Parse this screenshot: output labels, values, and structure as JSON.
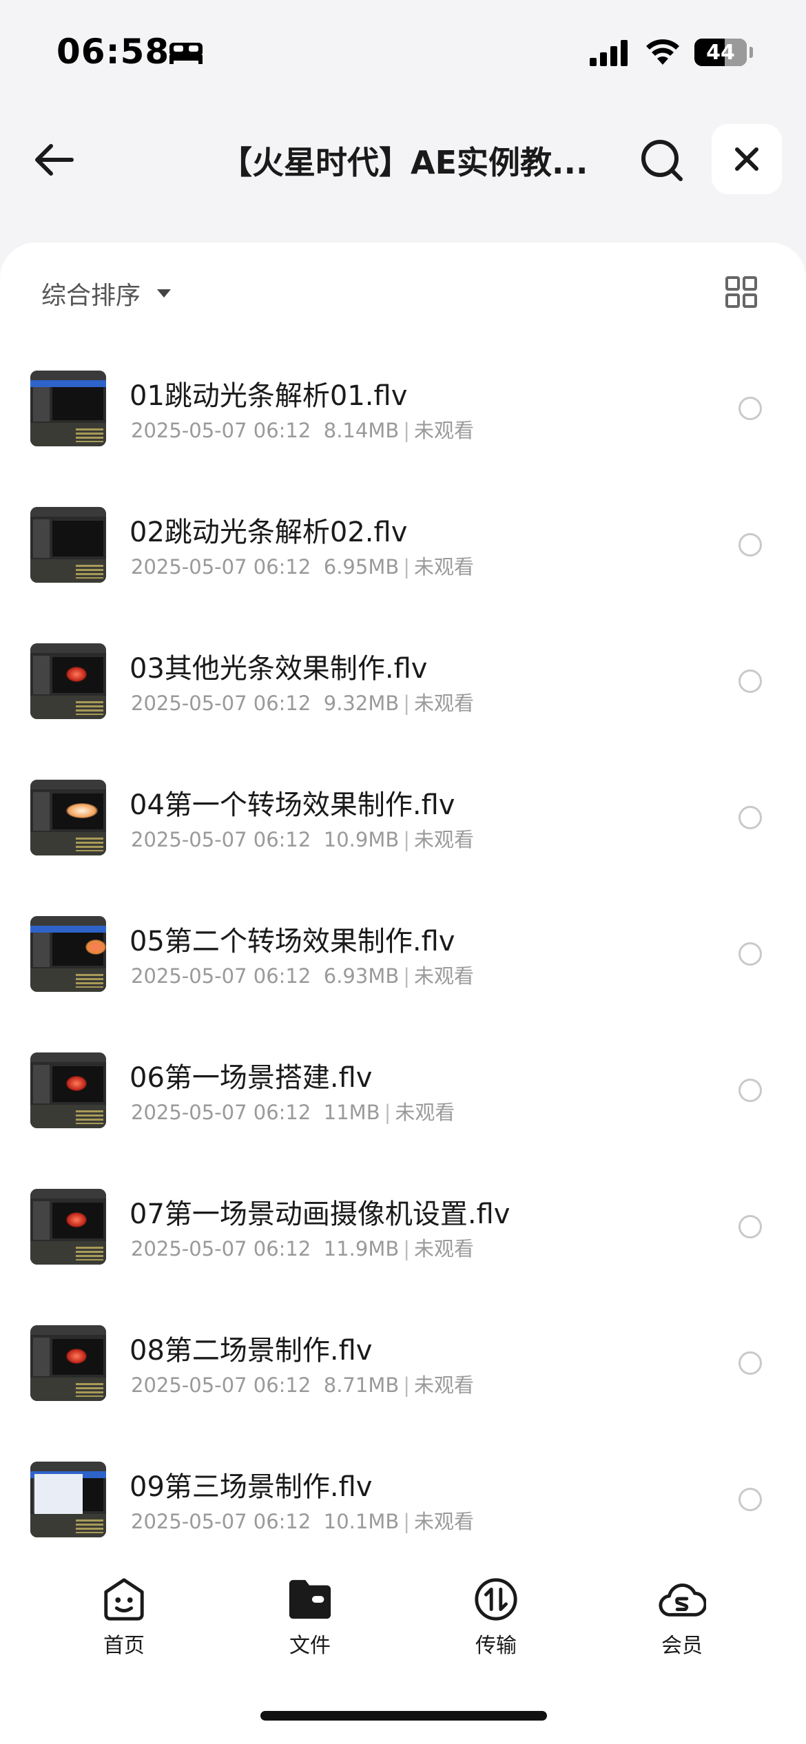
{
  "status_bar": {
    "time": "06:58",
    "battery": "44",
    "battery_level_percent": 44,
    "icons": [
      "bed-icon",
      "signal-icon",
      "wifi-icon",
      "battery-icon"
    ]
  },
  "header": {
    "title": "【火星时代】AE实例教...",
    "back_icon": "arrow-left-icon",
    "search_icon": "search-icon",
    "close_icon": "close-icon"
  },
  "toolbar": {
    "sort_label": "综合排序",
    "sort_icon": "caret-down-icon",
    "view_icon": "grid-view-icon"
  },
  "files": [
    {
      "name": "01跳动光条解析01.flv",
      "date": "2025-05-07 06:12",
      "size": "8.14MB",
      "status": "未观看",
      "thumb": "blue"
    },
    {
      "name": "02跳动光条解析02.flv",
      "date": "2025-05-07 06:12",
      "size": "6.95MB",
      "status": "未观看",
      "thumb": "dark"
    },
    {
      "name": "03其他光条效果制作.flv",
      "date": "2025-05-07 06:12",
      "size": "9.32MB",
      "status": "未观看",
      "thumb": "red"
    },
    {
      "name": "04第一个转场效果制作.flv",
      "date": "2025-05-07 06:12",
      "size": "10.9MB",
      "status": "未观看",
      "thumb": "orange"
    },
    {
      "name": "05第二个转场效果制作.flv",
      "date": "2025-05-07 06:12",
      "size": "6.93MB",
      "status": "未观看",
      "thumb": "blue-orange"
    },
    {
      "name": "06第一场景搭建.flv",
      "date": "2025-05-07 06:12",
      "size": "11MB",
      "status": "未观看",
      "thumb": "red"
    },
    {
      "name": "07第一场景动画摄像机设置.flv",
      "date": "2025-05-07 06:12",
      "size": "11.9MB",
      "status": "未观看",
      "thumb": "red"
    },
    {
      "name": "08第二场景制作.flv",
      "date": "2025-05-07 06:12",
      "size": "8.71MB",
      "status": "未观看",
      "thumb": "red"
    },
    {
      "name": "09第三场景制作.flv",
      "date": "2025-05-07 06:12",
      "size": "10.1MB",
      "status": "未观看",
      "thumb": "white"
    }
  ],
  "tabs": [
    {
      "label": "首页",
      "icon": "smile-face-icon"
    },
    {
      "label": "文件",
      "icon": "folder-icon"
    },
    {
      "label": "传输",
      "icon": "transfer-icon"
    },
    {
      "label": "会员",
      "icon": "cloud-member-icon"
    }
  ]
}
